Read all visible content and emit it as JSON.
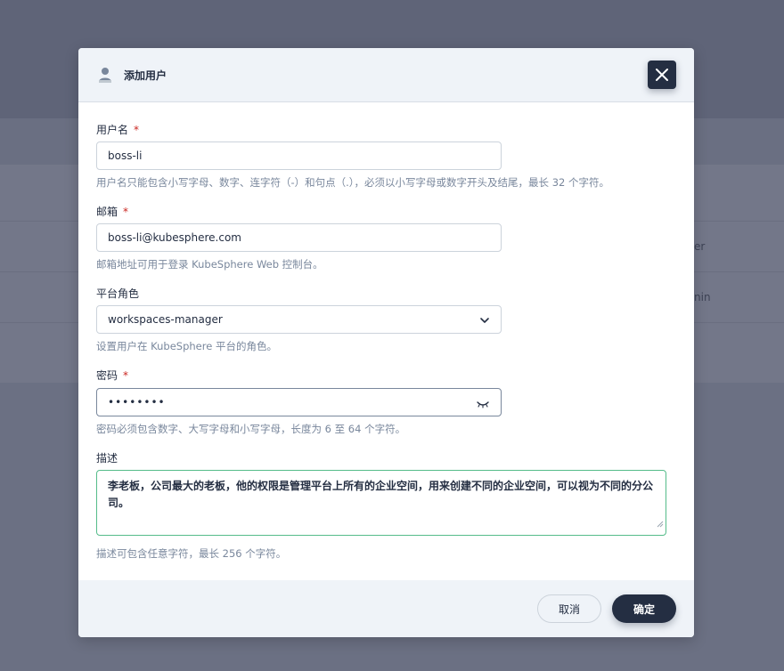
{
  "background": {
    "row1_fragment": "er",
    "row2_fragment": "nin"
  },
  "dialog": {
    "title": "添加用户",
    "header_icon": "user-icon",
    "close_icon": "close-icon"
  },
  "form": {
    "username": {
      "label": "用户名",
      "required_mark": "*",
      "value": "boss-li",
      "hint": "用户名只能包含小写字母、数字、连字符（-）和句点（.），必须以小写字母或数字开头及结尾，最长 32 个字符。"
    },
    "email": {
      "label": "邮箱",
      "required_mark": "*",
      "value": "boss-li@kubesphere.com",
      "hint": "邮箱地址可用于登录 KubeSphere Web 控制台。"
    },
    "role": {
      "label": "平台角色",
      "value": "workspaces-manager",
      "hint": "设置用户在 KubeSphere 平台的角色。",
      "icon": "chevron-down-icon"
    },
    "password": {
      "label": "密码",
      "required_mark": "*",
      "value": "••••••••",
      "hint": "密码必须包含数字、大写字母和小写字母，长度为 6 至 64 个字符。",
      "icon": "eye-closed-icon"
    },
    "description": {
      "label": "描述",
      "value": "李老板，公司最大的老板，他的权限是管理平台上所有的企业空间，用来创建不同的企业空间，可以视为不同的分公司。",
      "hint": "描述可包含任意字符，最长 256 个字符。"
    }
  },
  "footer": {
    "cancel_label": "取消",
    "ok_label": "确定"
  },
  "colors": {
    "accent": "#242e42",
    "required": "#ca2621",
    "focus_green": "#55bc8a",
    "hint_gray": "#79879c"
  }
}
